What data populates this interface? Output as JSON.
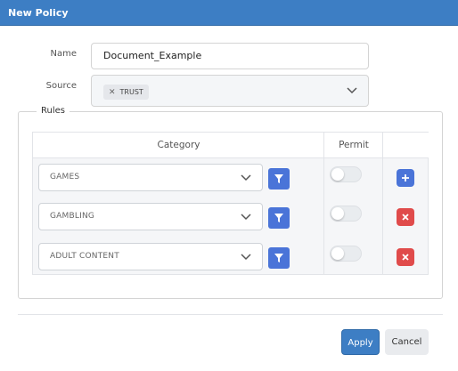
{
  "dialog": {
    "title": "New Policy"
  },
  "form": {
    "name_label": "Name",
    "name_value": "Document_Example",
    "source_label": "Source",
    "source_chips": [
      {
        "label": "TRUST",
        "remove_icon": "close-icon"
      }
    ]
  },
  "rules": {
    "legend": "Rules",
    "columns": {
      "category": "Category",
      "permit": "Permit"
    },
    "rows": [
      {
        "category": "GAMES",
        "permit": false,
        "action": "add"
      },
      {
        "category": "GAMBLING",
        "permit": false,
        "action": "delete"
      },
      {
        "category": "ADULT CONTENT",
        "permit": false,
        "action": "delete"
      }
    ]
  },
  "footer": {
    "apply_label": "Apply",
    "cancel_label": "Cancel"
  },
  "colors": {
    "titlebar": "#3d7ec4",
    "primary": "#4a74d8",
    "danger": "#e04b4b",
    "toggle_off": "#e9ecef"
  }
}
